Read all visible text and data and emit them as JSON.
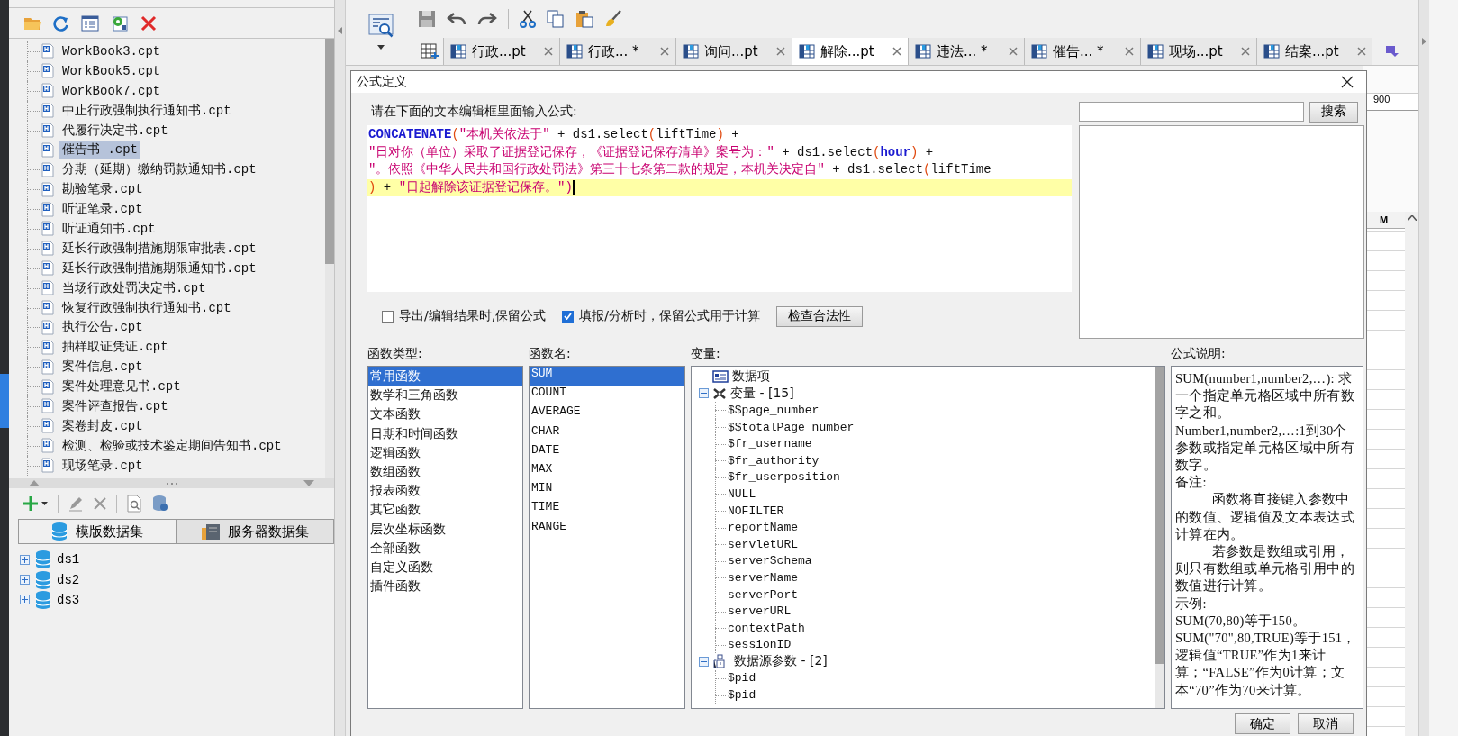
{
  "template_files": {
    "items": [
      {
        "label": "WorkBook3.cpt",
        "selected": false
      },
      {
        "label": "WorkBook5.cpt",
        "selected": false
      },
      {
        "label": "WorkBook7.cpt",
        "selected": false
      },
      {
        "label": "中止行政强制执行通知书.cpt",
        "selected": false
      },
      {
        "label": "代履行决定书.cpt",
        "selected": false
      },
      {
        "label": "催告书 .cpt",
        "selected": true
      },
      {
        "label": "分期（延期）缴纳罚款通知书.cpt",
        "selected": false
      },
      {
        "label": "勘验笔录.cpt",
        "selected": false
      },
      {
        "label": "听证笔录.cpt",
        "selected": false
      },
      {
        "label": "听证通知书.cpt",
        "selected": false
      },
      {
        "label": "延长行政强制措施期限审批表.cpt",
        "selected": false
      },
      {
        "label": "延长行政强制措施期限通知书.cpt",
        "selected": false
      },
      {
        "label": "当场行政处罚决定书.cpt",
        "selected": false
      },
      {
        "label": "恢复行政强制执行通知书.cpt",
        "selected": false
      },
      {
        "label": "执行公告.cpt",
        "selected": false
      },
      {
        "label": "抽样取证凭证.cpt",
        "selected": false
      },
      {
        "label": "案件信息.cpt",
        "selected": false
      },
      {
        "label": "案件处理意见书.cpt",
        "selected": false
      },
      {
        "label": "案件评查报告.cpt",
        "selected": false
      },
      {
        "label": "案卷封皮.cpt",
        "selected": false
      },
      {
        "label": "检测、检验或技术鉴定期间告知书.cpt",
        "selected": false
      },
      {
        "label": "现场笔录.cpt",
        "selected": false
      }
    ]
  },
  "dataset_tabs": [
    {
      "label": "模版数据集",
      "selected": true
    },
    {
      "label": "服务器数据集",
      "selected": false
    }
  ],
  "datasets": [
    {
      "label": "ds1",
      "expanded": false
    },
    {
      "label": "ds2",
      "expanded": false
    },
    {
      "label": "ds3",
      "expanded": false
    }
  ],
  "editor_tabs": [
    {
      "label": "行政...pt",
      "selected": false
    },
    {
      "label": "行政... *",
      "selected": false
    },
    {
      "label": "询问...pt",
      "selected": false
    },
    {
      "label": "解除...pt",
      "selected": true
    },
    {
      "label": "违法... *",
      "selected": false
    },
    {
      "label": "催告... *",
      "selected": false
    },
    {
      "label": "现场...pt",
      "selected": false
    },
    {
      "label": "结案...pt",
      "selected": false
    }
  ],
  "sheet": {
    "ruler_label": "900",
    "column_header": "M"
  },
  "dialog": {
    "title": "公式定义",
    "prompt": "请在下面的文本编辑框里面输入公式:",
    "formula_lines": [
      {
        "current": false,
        "tokens": [
          {
            "kind": "keyword",
            "text": "CONCATENATE"
          },
          {
            "kind": "paren",
            "text": "("
          },
          {
            "kind": "string",
            "text": "\"本机关依法于\""
          },
          {
            "kind": "plain",
            "text": " + ds1.select"
          },
          {
            "kind": "paren",
            "text": "("
          },
          {
            "kind": "plain",
            "text": "liftTime"
          },
          {
            "kind": "paren",
            "text": ")"
          },
          {
            "kind": "plain",
            "text": " +"
          }
        ]
      },
      {
        "current": false,
        "tokens": [
          {
            "kind": "string",
            "text": "\"日对你（单位）采取了证据登记保存，《证据登记保存清单》案号为：\""
          },
          {
            "kind": "plain",
            "text": " + ds1.select"
          },
          {
            "kind": "paren",
            "text": "("
          },
          {
            "kind": "keyword",
            "text": "hour"
          },
          {
            "kind": "paren",
            "text": ")"
          },
          {
            "kind": "plain",
            "text": " +"
          }
        ]
      },
      {
        "current": false,
        "tokens": [
          {
            "kind": "string",
            "text": "\"。依照《中华人民共和国行政处罚法》第三十七条第二款的规定，本机关决定自\""
          },
          {
            "kind": "plain",
            "text": " + ds1.select"
          },
          {
            "kind": "paren",
            "text": "("
          },
          {
            "kind": "plain",
            "text": "liftTime"
          }
        ]
      },
      {
        "current": true,
        "tokens": [
          {
            "kind": "paren",
            "text": ")"
          },
          {
            "kind": "plain",
            "text": " + "
          },
          {
            "kind": "string",
            "text": "\"日起解除该证据登记保存。\""
          },
          {
            "kind": "string",
            "text": ")"
          }
        ]
      }
    ],
    "search_button": "搜索",
    "options": [
      {
        "label": "导出/编辑结果时,保留公式",
        "checked": false
      },
      {
        "label": "填报/分析时，保留公式用于计算",
        "checked": true
      }
    ],
    "check_button": "检查合法性",
    "function_types": {
      "label": "函数类型:",
      "items": [
        {
          "label": "常用函数",
          "selected": true
        },
        {
          "label": "数学和三角函数",
          "selected": false
        },
        {
          "label": "文本函数",
          "selected": false
        },
        {
          "label": "日期和时间函数",
          "selected": false
        },
        {
          "label": "逻辑函数",
          "selected": false
        },
        {
          "label": "数组函数",
          "selected": false
        },
        {
          "label": "报表函数",
          "selected": false
        },
        {
          "label": "其它函数",
          "selected": false
        },
        {
          "label": "层次坐标函数",
          "selected": false
        },
        {
          "label": "全部函数",
          "selected": false
        },
        {
          "label": "自定义函数",
          "selected": false
        },
        {
          "label": "插件函数",
          "selected": false
        }
      ]
    },
    "function_names": {
      "label": "函数名:",
      "items": [
        {
          "label": "SUM",
          "selected": true
        },
        {
          "label": "COUNT",
          "selected": false
        },
        {
          "label": "AVERAGE",
          "selected": false
        },
        {
          "label": "CHAR",
          "selected": false
        },
        {
          "label": "DATE",
          "selected": false
        },
        {
          "label": "MAX",
          "selected": false
        },
        {
          "label": "MIN",
          "selected": false
        },
        {
          "label": "TIME",
          "selected": false
        },
        {
          "label": "RANGE",
          "selected": false
        }
      ]
    },
    "variables": {
      "label": "变量:",
      "items": [
        {
          "kind": "data-item",
          "label": "数据项"
        },
        {
          "kind": "variables",
          "label": "变量 - [15]",
          "expanded": true,
          "children": [
            {
              "label": "$$page_number"
            },
            {
              "label": "$$totalPage_number"
            },
            {
              "label": "$fr_username"
            },
            {
              "label": "$fr_authority"
            },
            {
              "label": "$fr_userposition"
            },
            {
              "label": "NULL"
            },
            {
              "label": "NOFILTER"
            },
            {
              "label": "reportName"
            },
            {
              "label": "servletURL"
            },
            {
              "label": "serverSchema"
            },
            {
              "label": "serverName"
            },
            {
              "label": "serverPort"
            },
            {
              "label": "serverURL"
            },
            {
              "label": "contextPath"
            },
            {
              "label": "sessionID"
            }
          ]
        },
        {
          "kind": "parameters",
          "label": "数据源参数 - [2]",
          "expanded": true,
          "children": [
            {
              "label": "$pid"
            },
            {
              "label": "$pid"
            }
          ]
        }
      ]
    },
    "description": {
      "label": "公式说明:",
      "paragraphs": [
        {
          "text": "SUM(number1,number2,…): 求一个指定单元格区域中所有数字之和。",
          "indent": false
        },
        {
          "text": "Number1,number2,…:1到30个参数或指定单元格区域中所有数字。",
          "indent": false
        },
        {
          "text": "备注:",
          "indent": false
        },
        {
          "text": "函数将直接键入参数中的数值、逻辑值及文本表达式计算在内。",
          "indent": true
        },
        {
          "text": "若参数是数组或引用，则只有数组或单元格引用中的数值进行计算。",
          "indent": true
        },
        {
          "text": "示例:",
          "indent": false
        },
        {
          "text": "SUM(70,80)等于150。",
          "indent": false
        },
        {
          "text": "SUM(\"70\",80,TRUE)等于151，逻辑值“TRUE”作为1来计算；“FALSE”作为0计算；文本“70”作为70来计算。",
          "indent": false
        }
      ]
    },
    "buttons": [
      "确定",
      "取消"
    ]
  }
}
